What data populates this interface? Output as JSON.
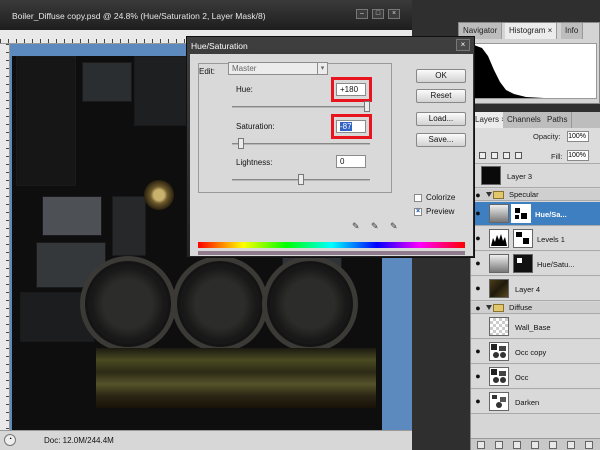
{
  "document": {
    "title": "Boiler_Diffuse copy.psd @ 24.8% (Hue/Saturation 2, Layer Mask/8)",
    "status": "Doc: 12.0M/244.4M"
  },
  "panels": {
    "top_tabs": [
      "Navigator",
      "Histogram ×",
      "Info"
    ],
    "layers_tabs": [
      "Layers ×",
      "Channels",
      "Paths"
    ],
    "opacity_label": "Opacity:",
    "opacity_value": "100%",
    "fill_label": "Fill:",
    "fill_value": "100%",
    "layers": [
      {
        "name": "Layer 3",
        "kind": "layer"
      },
      {
        "name": "Specular",
        "kind": "group"
      },
      {
        "name": "Hue/Sa...",
        "kind": "adjustment",
        "selected": true
      },
      {
        "name": "Levels 1",
        "kind": "adjustment"
      },
      {
        "name": "Hue/Satu...",
        "kind": "adjustment"
      },
      {
        "name": "Layer 4",
        "kind": "layer"
      },
      {
        "name": "Diffuse",
        "kind": "group"
      },
      {
        "name": "Wall_Base",
        "kind": "layer"
      },
      {
        "name": "Occ copy",
        "kind": "layer"
      },
      {
        "name": "Occ",
        "kind": "layer"
      },
      {
        "name": "Darken",
        "kind": "layer"
      }
    ]
  },
  "dialog": {
    "title": "Hue/Saturation",
    "edit_label": "Edit:",
    "edit_value": "Master",
    "hue_label": "Hue:",
    "hue_value": "+180",
    "saturation_label": "Saturation:",
    "saturation_value": "-87",
    "lightness_label": "Lightness:",
    "lightness_value": "0",
    "buttons": {
      "ok": "OK",
      "reset": "Reset",
      "load": "Load...",
      "save": "Save..."
    },
    "colorize_label": "Colorize",
    "colorize_checked": false,
    "preview_label": "Preview",
    "preview_checked": true,
    "highlight_color": "#e8141e"
  }
}
